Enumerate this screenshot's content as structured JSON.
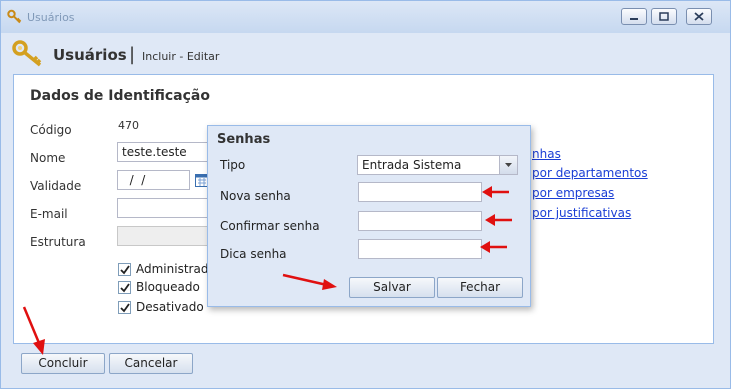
{
  "window": {
    "title": "Usuários"
  },
  "header": {
    "title": "Usuários",
    "separator": "|",
    "subtitle": "Incluir - Editar"
  },
  "form": {
    "section_title": "Dados de Identificação",
    "codigo_label": "Código",
    "codigo_value": "470",
    "nome_label": "Nome",
    "nome_value": "teste.teste",
    "validade_label": "Validade",
    "validade_value": "  /  /",
    "email_label": "E-mail",
    "email_value": "",
    "estrutura_label": "Estrutura",
    "estrutura_value": "",
    "checkboxes": [
      {
        "label": "Administrador",
        "checked": true
      },
      {
        "label": "Bloqueado",
        "checked": true
      },
      {
        "label": "Desativado",
        "checked": true
      }
    ],
    "links": [
      "nhas",
      "por departamentos",
      "por empresas",
      "por justificativas"
    ]
  },
  "dialog": {
    "title": "Senhas",
    "tipo_label": "Tipo",
    "tipo_value": "Entrada Sistema",
    "nova_senha_label": "Nova senha",
    "confirmar_senha_label": "Confirmar senha",
    "dica_senha_label": "Dica senha",
    "save_label": "Salvar",
    "close_label": "Fechar"
  },
  "footer": {
    "concluir_label": "Concluir",
    "cancelar_label": "Cancelar"
  },
  "colors": {
    "accent_border": "#99bbe8",
    "background": "#dfe8f6",
    "link": "#1a3ed5",
    "annotation_arrow": "#e01010"
  }
}
